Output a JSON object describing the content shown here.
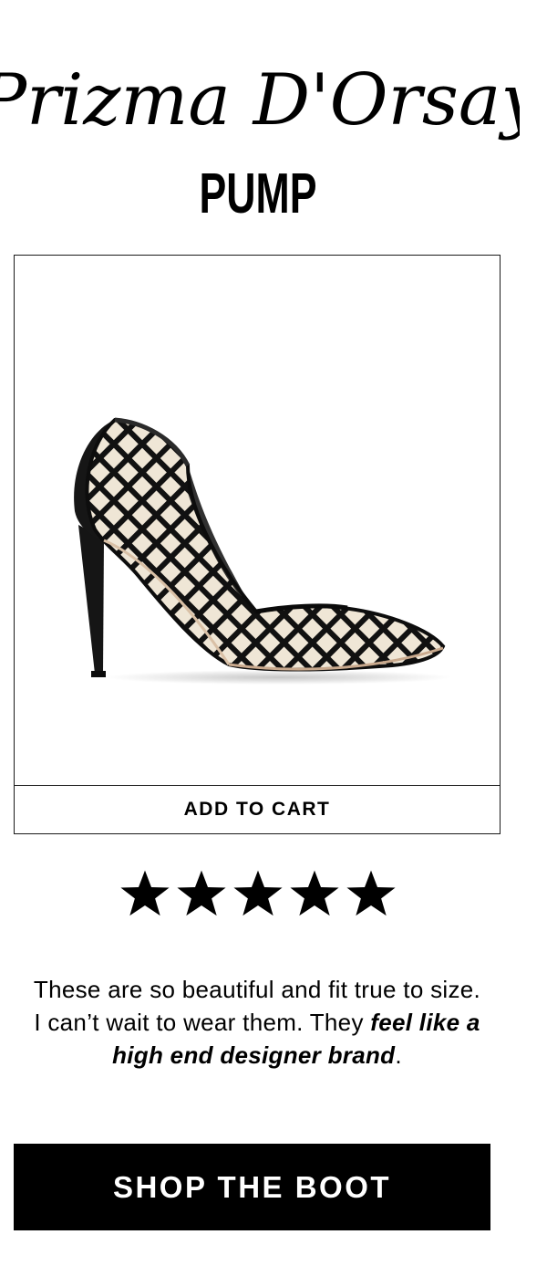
{
  "header": {
    "script_title": "Prizma D'Orsay",
    "subtitle": "PUMP"
  },
  "product": {
    "image_icon": "black-mesh-dorsay-pump-image",
    "add_to_cart_label": "ADD TO CART"
  },
  "rating": {
    "stars": 5,
    "max_stars": 5,
    "star_icon": "star-icon"
  },
  "review": {
    "text_plain_1": "These are so beautiful and fit true to size. I can’t wait to wear them. They ",
    "text_emphasis": "feel like a high end designer brand",
    "text_plain_2": "."
  },
  "cta": {
    "label": "SHOP THE BOOT"
  },
  "colors": {
    "background": "#ffffff",
    "text": "#000000",
    "button_bg": "#000000",
    "button_text": "#ffffff",
    "border": "#1a1a1a"
  }
}
